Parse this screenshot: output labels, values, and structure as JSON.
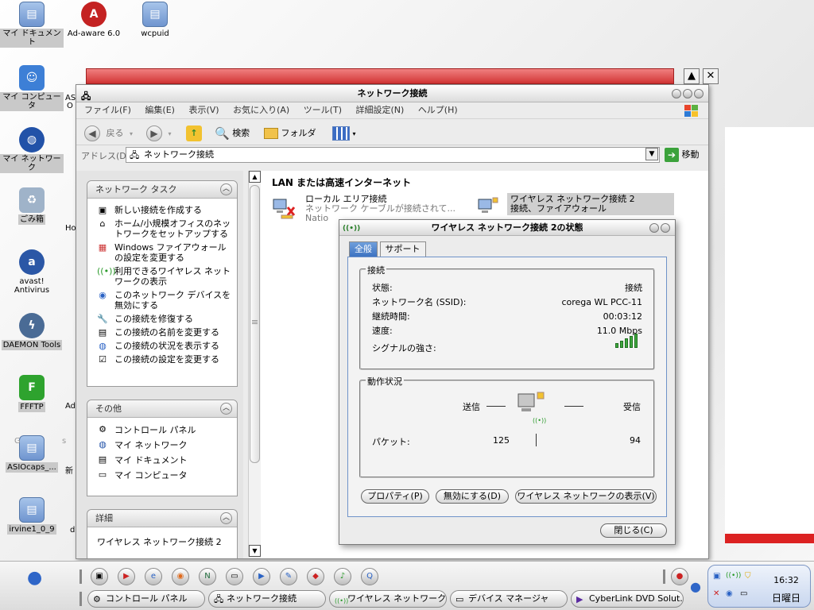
{
  "desktop": {
    "icons": [
      {
        "label": "マイ ドキュメント",
        "glyph": "▤"
      },
      {
        "label": "Ad-aware 6.0",
        "glyph": "A"
      },
      {
        "label": "wcpuid",
        "glyph": "▤"
      },
      {
        "label": "マイ コンピュータ",
        "glyph": "☺"
      },
      {
        "label": "マイ ネットワーク",
        "glyph": "◍"
      },
      {
        "label": "ごみ箱",
        "glyph": "♻"
      },
      {
        "label": "avast! Antivirus",
        "glyph": "a"
      },
      {
        "label": "DAEMON Tools",
        "glyph": "ϟ"
      },
      {
        "label": "FFFTP",
        "glyph": "F"
      },
      {
        "label": "ASIOcaps_...",
        "glyph": "▤"
      },
      {
        "label": "irvine1_0_9",
        "glyph": "▤"
      }
    ],
    "partial_labels": [
      "AS",
      "O",
      "Ho",
      "Ad",
      "新",
      "G",
      "s",
      "d"
    ]
  },
  "window": {
    "title": "ネットワーク接続",
    "menu": [
      "ファイル(F)",
      "編集(E)",
      "表示(V)",
      "お気に入り(A)",
      "ツール(T)",
      "詳細設定(N)",
      "ヘルプ(H)"
    ],
    "toolbar": {
      "back": "戻る",
      "search": "検索",
      "folders": "フォルダ"
    },
    "address": {
      "label": "アドレス(D)",
      "value": "ネットワーク接続",
      "go": "移動"
    },
    "tasks": {
      "network_header": "ネットワーク タスク",
      "network_items": [
        {
          "label": "新しい接続を作成する",
          "icon": "new-connection-icon"
        },
        {
          "label": "ホーム/小規模オフィスのネットワークをセットアップする",
          "icon": "home-network-icon"
        },
        {
          "label": "Windows ファイアウォールの設定を変更する",
          "icon": "firewall-icon"
        },
        {
          "label": "利用できるワイヤレス ネットワークの表示",
          "icon": "wireless-icon"
        },
        {
          "label": "このネットワーク デバイスを無効にする",
          "icon": "disable-device-icon"
        },
        {
          "label": "この接続を修復する",
          "icon": "repair-icon"
        },
        {
          "label": "この接続の名前を変更する",
          "icon": "rename-icon"
        },
        {
          "label": "この接続の状況を表示する",
          "icon": "status-icon"
        },
        {
          "label": "この接続の設定を変更する",
          "icon": "settings-icon"
        }
      ],
      "other_header": "その他",
      "other_items": [
        {
          "label": "コントロール パネル",
          "icon": "control-panel-icon"
        },
        {
          "label": "マイ ネットワーク",
          "icon": "my-network-icon"
        },
        {
          "label": "マイ ドキュメント",
          "icon": "my-documents-icon"
        },
        {
          "label": "マイ コンピュータ",
          "icon": "my-computer-icon"
        }
      ],
      "detail_header": "詳細",
      "detail_text": "ワイヤレス ネットワーク接続 2"
    },
    "main": {
      "group": "LAN または高速インターネット",
      "local": {
        "name": "ローカル エリア接続",
        "status": "ネットワーク ケーブルが接続されて...",
        "sub": "Natio"
      },
      "wireless": {
        "name": "ワイヤレス ネットワーク接続 2",
        "status": "接続、ファイアウォール"
      }
    }
  },
  "dialog": {
    "title": "ワイヤレス ネットワーク接続 2の状態",
    "tabs": [
      "全般",
      "サポート"
    ],
    "connection": {
      "legend": "接続",
      "rows": [
        {
          "label": "状態:",
          "value": "接続"
        },
        {
          "label": "ネットワーク名 (SSID):",
          "value": "corega WL PCC-11"
        },
        {
          "label": "継続時間:",
          "value": "00:03:12"
        },
        {
          "label": "速度:",
          "value": "11.0 Mbps"
        },
        {
          "label": "シグナルの強さ:",
          "value": ""
        }
      ],
      "signal_bars": 5
    },
    "activity": {
      "legend": "動作状況",
      "sent_label": "送信",
      "recv_label": "受信",
      "packets_label": "パケット:",
      "packets_sent": "125",
      "packets_recv": "94"
    },
    "buttons": {
      "properties": "プロパティ(P)",
      "disable": "無効にする(D)",
      "view_wireless": "ワイヤレス ネットワークの表示(V)",
      "close": "閉じる(C)"
    }
  },
  "taskbar": {
    "tasks": [
      "コントロール パネル",
      "ネットワーク接続",
      "ワイヤレス ネットワーク...",
      "デバイス マネージャ",
      "CyberLink DVD Solut..."
    ],
    "clock": "16:32",
    "day": "日曜日"
  },
  "colors": {
    "accent": "#3a70c0",
    "signal": "#3fa83f",
    "titlebar_red": "#d23434"
  }
}
